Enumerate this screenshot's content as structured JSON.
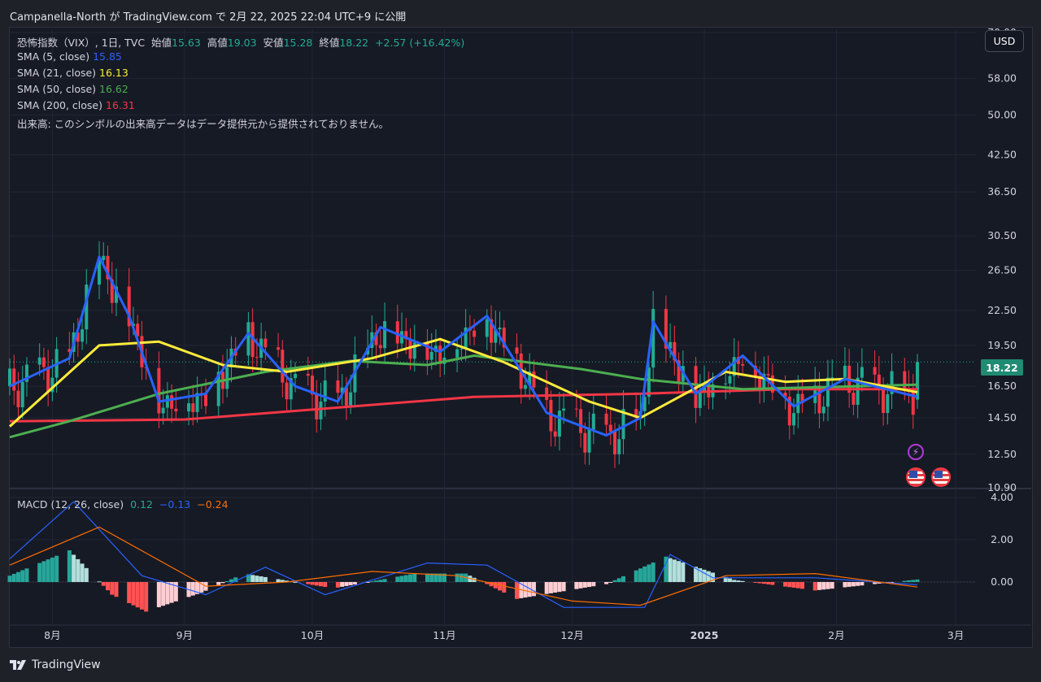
{
  "header": {
    "title": "Campanella-North が TradingView.com で 2月 22, 2025 22:04 UTC+9 に公開"
  },
  "toolbar": {
    "currency": "USD"
  },
  "legend": {
    "symbol": "恐怖指数（VIX）, 1日, TVC",
    "open_label": "始値",
    "open": "15.63",
    "high_label": "高値",
    "high": "19.03",
    "low_label": "安値",
    "low": "15.28",
    "close_label": "終値",
    "close": "18.22",
    "change": "+2.57 (+16.42%)",
    "sma5_label": "SMA (5, close)",
    "sma5": "15.85",
    "sma21_label": "SMA (21, close)",
    "sma21": "16.13",
    "sma50_label": "SMA (50, close)",
    "sma50": "16.62",
    "sma200_label": "SMA (200, close)",
    "sma200": "16.31",
    "volume_note": "出来高: このシンボルの出来高データはデータ提供元から提供されておりません。",
    "macd_label": "MACD (12, 26, close)",
    "macd_hist": "0.12",
    "macd_line": "−0.13",
    "macd_signal": "−0.24"
  },
  "last_price": "18.22",
  "footer": {
    "brand": "TradingView"
  },
  "colors": {
    "sma5": "#2962ff",
    "sma21": "#ffeb3b",
    "sma50": "#4caf50",
    "sma200": "#f23645",
    "up": "#22ab94",
    "down": "#f23645",
    "macd": "#2962ff",
    "signal": "#ff6d00"
  },
  "icons": [
    "lightning-event-icon",
    "us-flag-event-icon",
    "us-flag-event-icon"
  ],
  "chart_data": [
    {
      "type": "candlestick",
      "ylim": [
        10.9,
        70.0
      ],
      "y_scale": "log",
      "y_ticks": [
        "70.00",
        "58.00",
        "50.00",
        "42.50",
        "36.50",
        "30.50",
        "26.50",
        "22.50",
        "19.50",
        "16.50",
        "14.50",
        "12.50",
        "10.90"
      ],
      "x_ticks": [
        "8月",
        "9月",
        "10月",
        "11月",
        "12月",
        "2025",
        "2月",
        "3月"
      ],
      "grid": true,
      "series": [
        {
          "name": "SMA (5, close)",
          "x": [
            "2024-07-22",
            "2024-08-05",
            "2024-08-12",
            "2024-08-19",
            "2024-08-26",
            "2024-09-06",
            "2024-09-16",
            "2024-09-27",
            "2024-10-07",
            "2024-10-17",
            "2024-10-31",
            "2024-11-11",
            "2024-11-25",
            "2024-12-09",
            "2024-12-17",
            "2024-12-20",
            "2024-12-30",
            "2025-01-10",
            "2025-01-22",
            "2025-02-03",
            "2025-02-20"
          ],
          "values": [
            16.5,
            18.5,
            28.0,
            22.0,
            15.5,
            16.0,
            20.5,
            16.5,
            15.5,
            21.0,
            19.0,
            22.0,
            14.8,
            13.5,
            14.5,
            21.5,
            16.0,
            18.7,
            15.2,
            17.0,
            15.8
          ]
        },
        {
          "name": "SMA (21, close)",
          "x": [
            "2024-07-22",
            "2024-08-12",
            "2024-08-26",
            "2024-09-10",
            "2024-09-25",
            "2024-10-15",
            "2024-10-31",
            "2024-11-15",
            "2024-12-05",
            "2024-12-17",
            "2025-01-06",
            "2025-01-20",
            "2025-02-03",
            "2025-02-20"
          ],
          "values": [
            14.0,
            19.5,
            19.8,
            18.0,
            17.5,
            18.5,
            20.0,
            18.2,
            15.5,
            14.5,
            17.5,
            16.8,
            17.0,
            16.1
          ]
        },
        {
          "name": "SMA (50, close)",
          "x": [
            "2024-07-22",
            "2024-08-05",
            "2024-08-26",
            "2024-09-20",
            "2024-10-10",
            "2024-10-28",
            "2024-11-08",
            "2024-12-03",
            "2024-12-17",
            "2025-01-10",
            "2025-02-20"
          ],
          "values": [
            13.4,
            14.3,
            16.0,
            17.5,
            18.3,
            18.0,
            18.7,
            17.7,
            17.0,
            16.3,
            16.6
          ]
        },
        {
          "name": "SMA (200, close)",
          "x": [
            "2024-07-22",
            "2024-09-01",
            "2024-10-01",
            "2024-11-08",
            "2024-12-17",
            "2025-01-20",
            "2025-02-20"
          ],
          "values": [
            14.3,
            14.4,
            15.0,
            15.8,
            16.0,
            16.3,
            16.3
          ]
        }
      ],
      "ohlc_last": {
        "open": 15.63,
        "high": 19.03,
        "low": 15.28,
        "close": 18.22
      }
    },
    {
      "type": "bar",
      "name": "MACD (12, 26, close)",
      "ylim": [
        -1.3,
        4.0
      ],
      "y_ticks": [
        "4.00",
        "2.00",
        "0.00"
      ],
      "series": [
        {
          "name": "MACD",
          "x": [
            "2024-07-22",
            "2024-08-06",
            "2024-08-22",
            "2024-09-06",
            "2024-09-20",
            "2024-10-04",
            "2024-10-28",
            "2024-11-11",
            "2024-11-29",
            "2024-12-18",
            "2024-12-24",
            "2025-01-03",
            "2025-01-27",
            "2025-02-20"
          ],
          "values": [
            1.1,
            3.8,
            0.3,
            -0.6,
            0.7,
            -0.6,
            0.9,
            0.8,
            -1.2,
            -1.2,
            1.3,
            0.2,
            0.2,
            -0.13
          ]
        },
        {
          "name": "Signal",
          "x": [
            "2024-07-22",
            "2024-08-12",
            "2024-09-06",
            "2024-09-25",
            "2024-10-15",
            "2024-11-04",
            "2024-12-01",
            "2024-12-17",
            "2025-01-06",
            "2025-01-27",
            "2025-02-20"
          ],
          "values": [
            0.8,
            2.6,
            -0.2,
            0.0,
            0.5,
            0.3,
            -0.9,
            -1.1,
            0.3,
            0.4,
            -0.24
          ]
        },
        {
          "name": "Histogram",
          "x": [
            "2024-07-22",
            "2024-08-05",
            "2024-08-15",
            "2024-08-23",
            "2024-09-05",
            "2024-09-15",
            "2024-10-06",
            "2024-10-25",
            "2024-11-06",
            "2024-11-18",
            "2024-12-09",
            "2024-12-23",
            "2025-01-08",
            "2025-01-27",
            "2025-02-20"
          ],
          "values": [
            0.3,
            1.5,
            -0.6,
            -1.4,
            -0.5,
            0.4,
            -0.3,
            0.4,
            0.4,
            -0.8,
            -0.1,
            1.2,
            0.1,
            -0.4,
            0.12
          ]
        }
      ]
    }
  ]
}
